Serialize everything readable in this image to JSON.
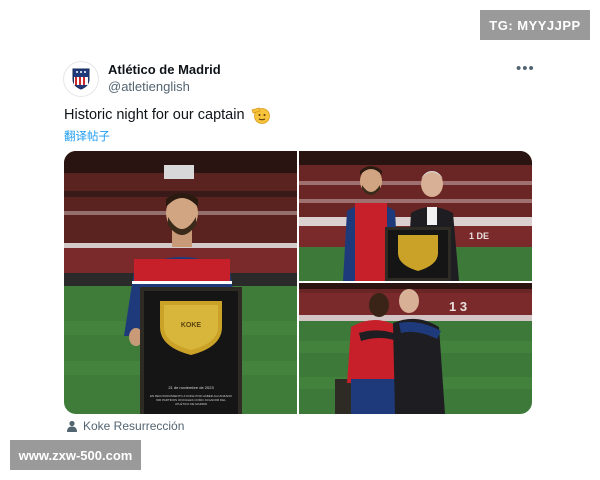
{
  "watermarks": {
    "top_right": "TG: MYYJJPP",
    "bottom_left": "www.zxw-500.com"
  },
  "tweet": {
    "author_name": "Atlético de Madrid",
    "author_handle": "@atletienglish",
    "avatar_icon": "atletico-crest-icon",
    "more_icon": "more-options-icon",
    "more_label": "•••",
    "text": "Historic night for our captain",
    "emoji_icon": "saluting-face-emoji",
    "translate_label": "翻译帖子",
    "media_credit": "Koke Resurrección",
    "credit_icon": "person-icon"
  },
  "photos": [
    {
      "plaque_name": "KOKE",
      "plaque_date": "21 de noviembre de 2023",
      "plaque_caption": "EN RECONOCIMIENTO A KOKE POR HABER ALCANZADO 600 PARTIDOS OFICIALES COMO JUGADOR DEL ATLÉTICO DE MADRID"
    },
    {
      "stand_text": "1 DE"
    },
    {
      "stand_text": "1 3"
    }
  ],
  "colors": {
    "link": "#1d9bf0",
    "secondary_text": "#536471",
    "pitch_green": "#3d7a3a",
    "stand_red": "#8a2a2a",
    "jersey_blue": "#1f3a7a",
    "jersey_red": "#c8202a",
    "plaque_gold": "#c9a227"
  }
}
